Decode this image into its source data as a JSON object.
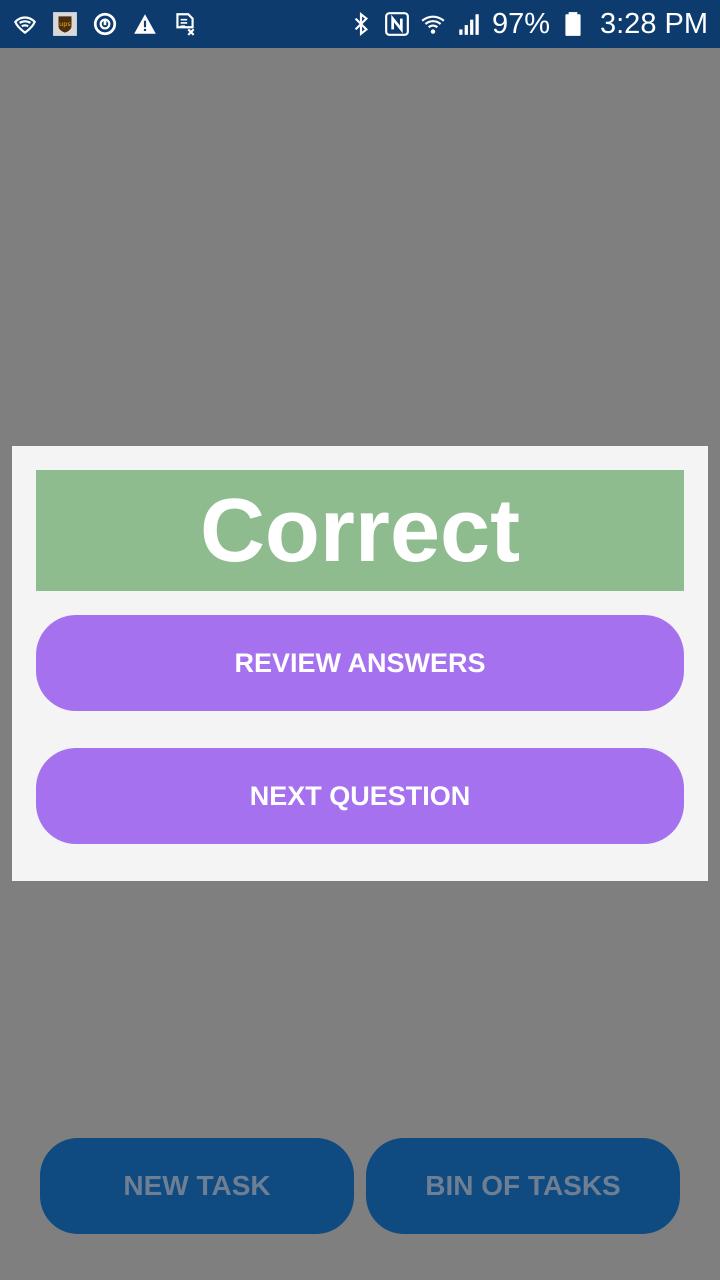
{
  "status_bar": {
    "left_icons": [
      "wifi-shield-icon",
      "ups-app-icon",
      "sync-icon",
      "warning-icon",
      "sim-off-icon"
    ],
    "right_icons": [
      "bluetooth-icon",
      "nfc-icon",
      "wifi-icon",
      "signal-icon",
      "battery-icon"
    ],
    "battery_percent": "97%",
    "time": "3:28 PM"
  },
  "background": {
    "new_task_label": "NEW TASK",
    "bin_of_tasks_label": "BIN OF TASKS"
  },
  "dialog": {
    "result": "Correct",
    "review_label": "REVIEW ANSWERS",
    "next_label": "NEXT QUESTION"
  },
  "colors": {
    "status_bar": "#0d3b6e",
    "overlay": "#7f7f7f",
    "correct_banner": "#8fbc8f",
    "dialog_button": "#a571ef",
    "bottom_button": "#0f4a80"
  }
}
